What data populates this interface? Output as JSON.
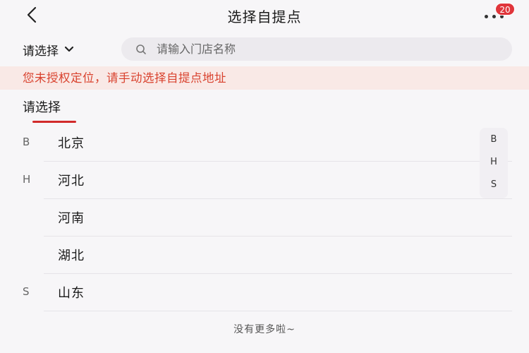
{
  "header": {
    "title": "选择自提点",
    "badge_count": "20"
  },
  "filter": {
    "region_label": "请选择",
    "search_placeholder": "请输入门店名称"
  },
  "notice": "您未授权定位，请手动选择自提点地址",
  "tab_label": "请选择",
  "regions": [
    {
      "letter": "B",
      "name": "北京"
    },
    {
      "letter": "H",
      "name": "河北"
    },
    {
      "letter": "",
      "name": "河南"
    },
    {
      "letter": "",
      "name": "湖北"
    },
    {
      "letter": "S",
      "name": "山东"
    }
  ],
  "index_letters": [
    "B",
    "H",
    "S"
  ],
  "footer": "没有更多啦~",
  "colors": {
    "accent": "#d12a2a",
    "notice_text": "#d9422e",
    "notice_bg": "#f9e9e6"
  }
}
